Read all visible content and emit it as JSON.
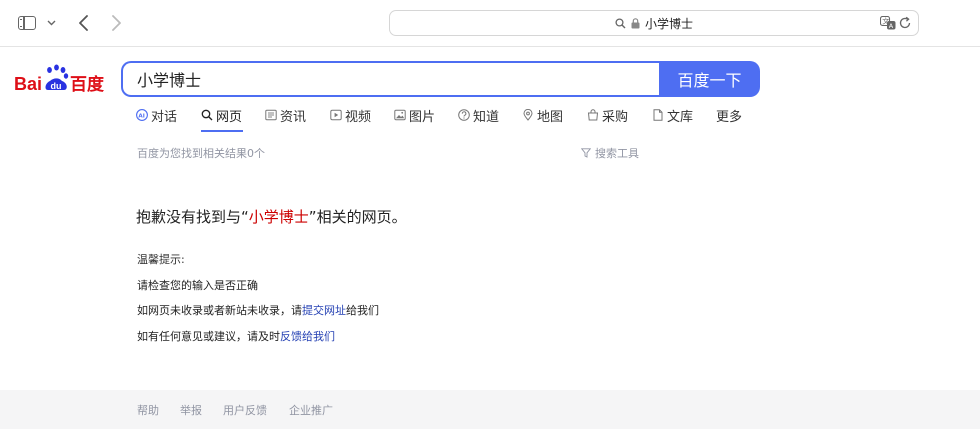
{
  "browser": {
    "address_text": "小学博士",
    "icons": [
      "sidebar-icon",
      "chevron-down-icon",
      "back-arrow-icon",
      "forward-arrow-icon",
      "search-icon",
      "lock-icon",
      "translate-icon",
      "reload-icon"
    ]
  },
  "header": {
    "logo": {
      "part1": "Bai",
      "part2": "du",
      "part3": "百度"
    },
    "search": {
      "value": "小学博士",
      "button_label": "百度一下"
    },
    "accent_color": "#4e6ef2"
  },
  "tabs": [
    {
      "label": "对话",
      "icon": "ai-chat-icon",
      "active": false
    },
    {
      "label": "网页",
      "icon": "search-icon",
      "active": true
    },
    {
      "label": "资讯",
      "icon": "news-icon",
      "active": false
    },
    {
      "label": "视频",
      "icon": "video-icon",
      "active": false
    },
    {
      "label": "图片",
      "icon": "image-icon",
      "active": false
    },
    {
      "label": "知道",
      "icon": "question-icon",
      "active": false
    },
    {
      "label": "地图",
      "icon": "map-pin-icon",
      "active": false
    },
    {
      "label": "采购",
      "icon": "shopping-bag-icon",
      "active": false
    },
    {
      "label": "文库",
      "icon": "document-icon",
      "active": false
    },
    {
      "label": "更多",
      "icon": "",
      "active": false
    }
  ],
  "results": {
    "count_text": "百度为您找到相关结果0个",
    "tools_label": "搜索工具"
  },
  "no_results": {
    "before": "抱歉没有找到与“",
    "keyword": "小学博士",
    "after": "”相关的网页。",
    "keyword_color": "#cc0000",
    "tips_title": "温馨提示:",
    "tip1": "请检查您的输入是否正确",
    "tip2_before": "如网页未收录或者新站未收录，请",
    "tip2_link": "提交网址",
    "tip2_after": "给我们",
    "tip3_before": "如有任何意见或建议，请及时",
    "tip3_link": "反馈给我们"
  },
  "footer": {
    "links": [
      "帮助",
      "举报",
      "用户反馈",
      "企业推广"
    ]
  }
}
